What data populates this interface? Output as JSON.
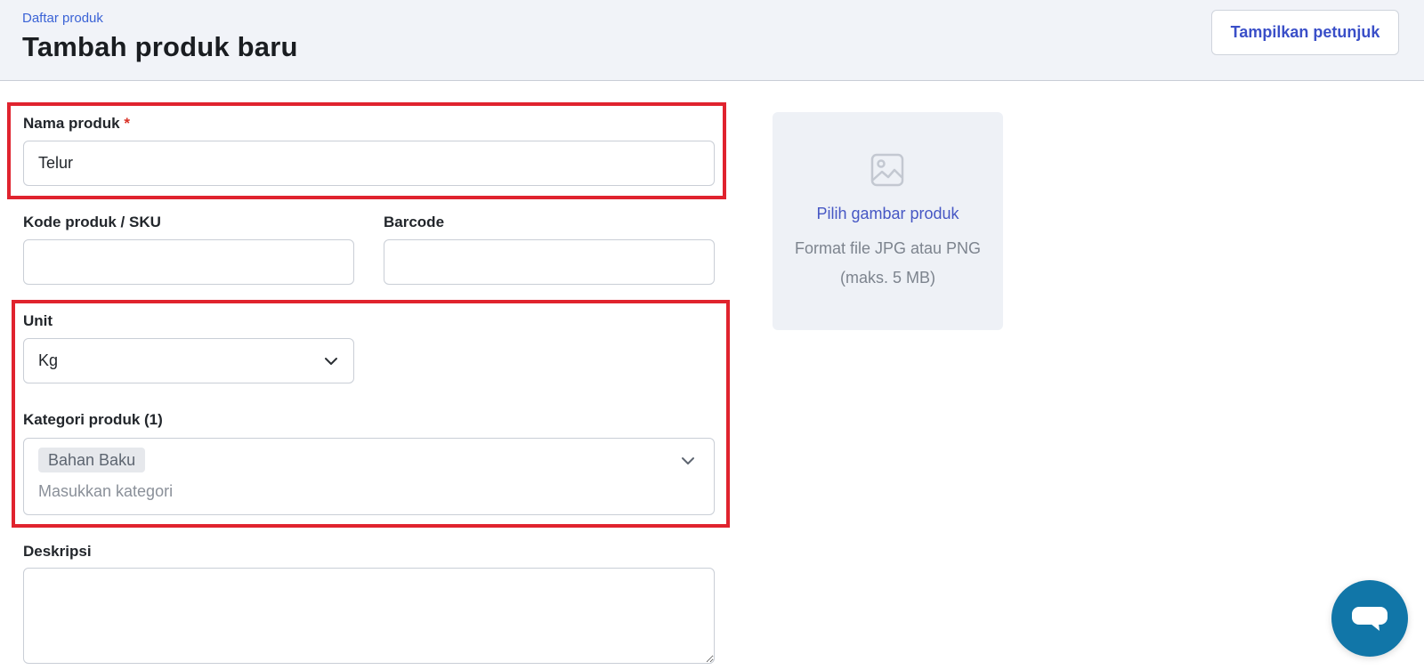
{
  "header": {
    "breadcrumb": "Daftar produk",
    "title": "Tambah produk baru",
    "guide_button": "Tampilkan petunjuk"
  },
  "form": {
    "product_name": {
      "label": "Nama produk",
      "required_mark": "*",
      "value": "Telur"
    },
    "sku": {
      "label": "Kode produk / SKU",
      "value": ""
    },
    "barcode": {
      "label": "Barcode",
      "value": ""
    },
    "unit": {
      "label": "Unit",
      "value": "Kg"
    },
    "category": {
      "label": "Kategori produk (1)",
      "selected": [
        "Bahan Baku"
      ],
      "placeholder": "Masukkan kategori"
    },
    "description": {
      "label": "Deskripsi",
      "value": ""
    }
  },
  "image_upload": {
    "icon": "image-icon",
    "title": "Pilih gambar produk",
    "hint": "Format file JPG atau PNG (maks. 5 MB)"
  },
  "chat": {
    "icon": "chat-bubble-icon"
  },
  "colors": {
    "accent": "#3a4fc8",
    "highlight": "#e0232e",
    "chat": "#1176a8",
    "header_bg": "#f1f3f8"
  }
}
